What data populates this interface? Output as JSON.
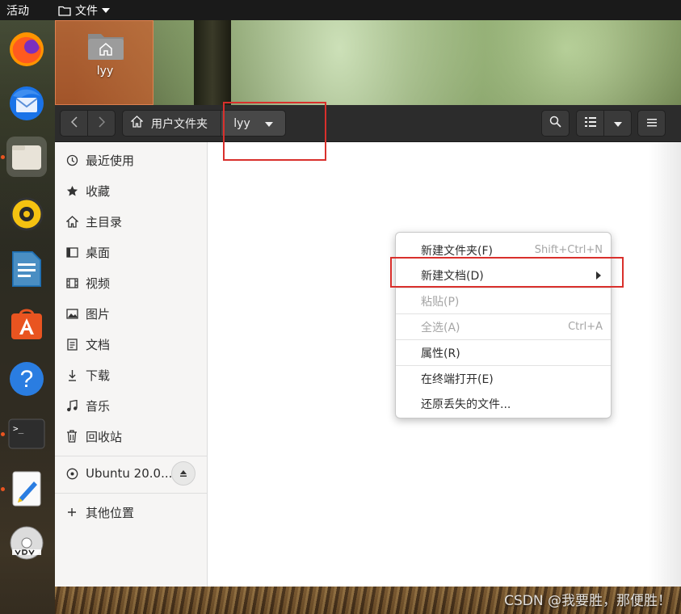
{
  "topbar": {
    "activities": "活动",
    "app_menu": "文件"
  },
  "desktop": {
    "folder_label": "lyy"
  },
  "dock": {
    "items": [
      {
        "name": "firefox-icon"
      },
      {
        "name": "thunderbird-icon"
      },
      {
        "name": "files-icon"
      },
      {
        "name": "rhythmbox-icon"
      },
      {
        "name": "libreoffice-writer-icon"
      },
      {
        "name": "software-center-icon"
      },
      {
        "name": "help-icon"
      },
      {
        "name": "terminal-icon"
      },
      {
        "name": "text-editor-icon"
      },
      {
        "name": "dvd-icon"
      }
    ],
    "help_glyph": "?",
    "terminal_glyph": ">_"
  },
  "header": {
    "breadcrumb_home": "用户文件夹",
    "breadcrumb_current": "lyy"
  },
  "sidebar": {
    "items": [
      {
        "label": "最近使用",
        "icon": "clock-icon"
      },
      {
        "label": "收藏",
        "icon": "star-icon"
      },
      {
        "label": "主目录",
        "icon": "home-icon"
      },
      {
        "label": "桌面",
        "icon": "desktop-icon"
      },
      {
        "label": "视频",
        "icon": "film-icon"
      },
      {
        "label": "图片",
        "icon": "image-icon"
      },
      {
        "label": "文档",
        "icon": "document-icon"
      },
      {
        "label": "下载",
        "icon": "download-icon"
      },
      {
        "label": "音乐",
        "icon": "music-icon"
      },
      {
        "label": "回收站",
        "icon": "trash-icon"
      }
    ],
    "device": {
      "label": "Ubuntu 20.0...",
      "icon": "disc-icon"
    },
    "other_locations": {
      "label": "其他位置",
      "icon": "plus-icon"
    }
  },
  "context_menu": {
    "items": [
      {
        "label": "新建文件夹(F)",
        "accel": "Shift+Ctrl+N",
        "enabled": true
      },
      {
        "label": "新建文档(D)",
        "accel": "",
        "enabled": true,
        "submenu": true
      },
      {
        "label": "粘贴(P)",
        "accel": "",
        "enabled": false
      },
      {
        "label": "全选(A)",
        "accel": "Ctrl+A",
        "enabled": false
      },
      {
        "label": "属性(R)",
        "accel": "",
        "enabled": true
      },
      {
        "label": "在终端打开(E)",
        "accel": "",
        "enabled": true
      },
      {
        "label": "还原丢失的文件...",
        "accel": "",
        "enabled": true
      }
    ]
  },
  "watermark": "CSDN @我要胜，那便胜！",
  "colors": {
    "accent": "#e95420",
    "annotation_red": "#d9302c"
  }
}
